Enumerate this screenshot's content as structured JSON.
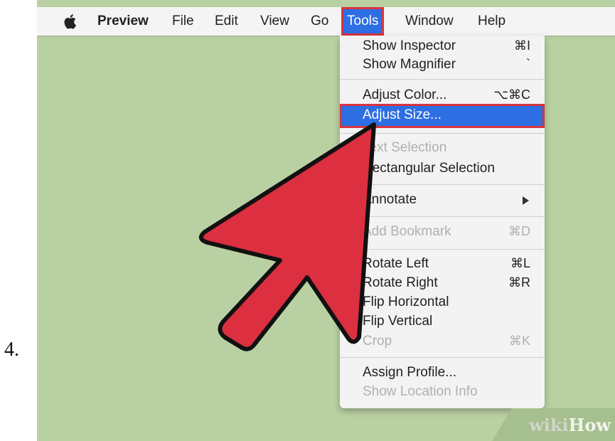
{
  "step": {
    "number": "4."
  },
  "colors": {
    "desktop": "#b9d1a2",
    "menubar": "#f4f4f4",
    "highlight": "#2d6ee3",
    "outline": "#d8343f",
    "arrow_fill": "#dc2f40",
    "arrow_stroke": "#111111"
  },
  "menubar": {
    "apple_icon": "apple-icon",
    "app_name": "Preview",
    "items": [
      {
        "label": "File"
      },
      {
        "label": "Edit"
      },
      {
        "label": "View"
      },
      {
        "label": "Go"
      },
      {
        "label": "Tools"
      },
      {
        "label": "Window"
      },
      {
        "label": "Help"
      }
    ],
    "active": "Tools"
  },
  "tools_menu": {
    "items": [
      {
        "label": "Show Inspector",
        "shortcut": "⌘I",
        "disabled": false
      },
      {
        "label": "Show Magnifier",
        "shortcut": "`",
        "disabled": false
      },
      {
        "label": "Adjust Color...",
        "shortcut": "⌥⌘C",
        "disabled": false
      },
      {
        "label": "Adjust Size...",
        "shortcut": "",
        "disabled": false,
        "highlighted": true
      },
      {
        "label": "Text Selection",
        "shortcut": "",
        "disabled": true
      },
      {
        "label": "Rectangular Selection",
        "shortcut": "",
        "disabled": false
      },
      {
        "label": "Annotate",
        "shortcut": "",
        "disabled": false,
        "submenu": true
      },
      {
        "label": "Add Bookmark",
        "shortcut": "⌘D",
        "disabled": true
      },
      {
        "label": "Rotate Left",
        "shortcut": "⌘L",
        "disabled": false
      },
      {
        "label": "Rotate Right",
        "shortcut": "⌘R",
        "disabled": false
      },
      {
        "label": "Flip Horizontal",
        "shortcut": "",
        "disabled": false
      },
      {
        "label": "Flip Vertical",
        "shortcut": "",
        "disabled": false
      },
      {
        "label": "Crop",
        "shortcut": "⌘K",
        "disabled": true
      },
      {
        "label": "Assign Profile...",
        "shortcut": "",
        "disabled": false
      },
      {
        "label": "Show Location Info",
        "shortcut": "",
        "disabled": true
      }
    ]
  },
  "pointer_arrow_icon": "pointer-arrow-icon",
  "watermark": {
    "part1": "wiki",
    "part2": "How"
  }
}
